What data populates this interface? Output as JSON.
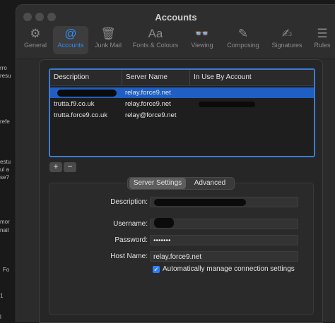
{
  "window": {
    "title": "Accounts"
  },
  "toolbar": {
    "items": [
      {
        "label": "General",
        "icon": "gear-icon"
      },
      {
        "label": "Accounts",
        "icon": "at-icon"
      },
      {
        "label": "Junk Mail",
        "icon": "trash-icon"
      },
      {
        "label": "Fonts & Colours",
        "icon": "font-icon"
      },
      {
        "label": "Viewing",
        "icon": "glasses-icon"
      },
      {
        "label": "Composing",
        "icon": "compose-icon"
      },
      {
        "label": "Signatures",
        "icon": "signature-icon"
      },
      {
        "label": "Rules",
        "icon": "rules-icon"
      }
    ]
  },
  "smtp_table": {
    "columns": [
      "Description",
      "Server Name",
      "In Use By Account"
    ],
    "rows": [
      {
        "description": "",
        "server": "relay.force9.net",
        "account": "",
        "selected": true
      },
      {
        "description": "trutta.f9.co.uk",
        "server": "relay.force9.net",
        "account": ""
      },
      {
        "description": "trutta.force9.co.uk",
        "server": "relay@force9.net",
        "account": ""
      }
    ]
  },
  "buttons": {
    "add": "+",
    "remove": "−"
  },
  "tabs": {
    "server_settings": "Server Settings",
    "advanced": "Advanced"
  },
  "form": {
    "description_label": "Description:",
    "description_value": "",
    "username_label": "Username:",
    "username_value": "",
    "password_label": "Password:",
    "password_value": "•••••••",
    "hostname_label": "Host Name:",
    "hostname_value": "relay.force9.net",
    "auto_manage_label": "Automatically manage connection settings",
    "auto_manage_checked": true
  },
  "background_fragments": [
    "rro",
    "resu",
    "refe",
    "estu",
    "ul a",
    "se?",
    "mor",
    "nail",
    "Fo",
    "1",
    "l"
  ],
  "colors": {
    "accent": "#2f7df6",
    "selection": "#1f5fc4"
  }
}
